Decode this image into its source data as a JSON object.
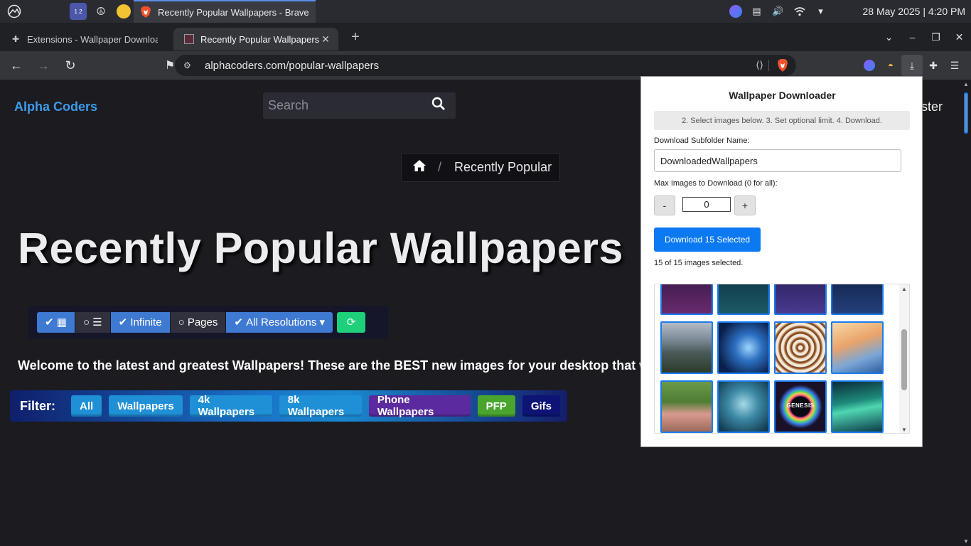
{
  "os": {
    "task_title": "Recently Popular Wallpapers - Brave",
    "clock": "28 May 2025 | 4:20 PM",
    "workspace_label": "1 2"
  },
  "tabs": [
    {
      "title": "Extensions - Wallpaper Downloader",
      "active": false
    },
    {
      "title": "Recently Popular Wallpapers",
      "active": true
    }
  ],
  "address_bar": {
    "url": "alphacoders.com/popular-wallpapers"
  },
  "site": {
    "brand": "Alpha Coders",
    "search_placeholder": "Search",
    "register_partial": "ster",
    "breadcrumb_current": "Recently Popular",
    "hero_title": "Recently Popular Wallpapers",
    "welcome": "Welcome to the latest and greatest Wallpapers! These are the BEST new images for your desktop that we"
  },
  "view_toggles": {
    "infinite": "Infinite",
    "pages": "Pages",
    "resolutions": "All Resolutions"
  },
  "filter_bar": {
    "label": "Filter:",
    "buttons": [
      "All",
      "Wallpapers",
      "4k Wallpapers",
      "8k Wallpapers",
      "Phone Wallpapers",
      "PFP",
      "Gifs"
    ]
  },
  "popup": {
    "title": "Wallpaper Downloader",
    "hint": "2. Select images below. 3. Set optional limit. 4. Download.",
    "subfolder_label": "Download Subfolder Name:",
    "subfolder_value": "DownloadedWallpapers",
    "max_label": "Max Images to Download (0 for all):",
    "minus": "-",
    "plus": "+",
    "max_value": "0",
    "download_button": "Download 15 Selected",
    "count": "15 of 15 images selected.",
    "genesis_caption": "GENESIS",
    "selected_count": 15
  },
  "colors": {
    "accent_blue": "#3d9be9",
    "popup_button": "#0b79f2",
    "thumb_border": "#1a7cf0"
  }
}
